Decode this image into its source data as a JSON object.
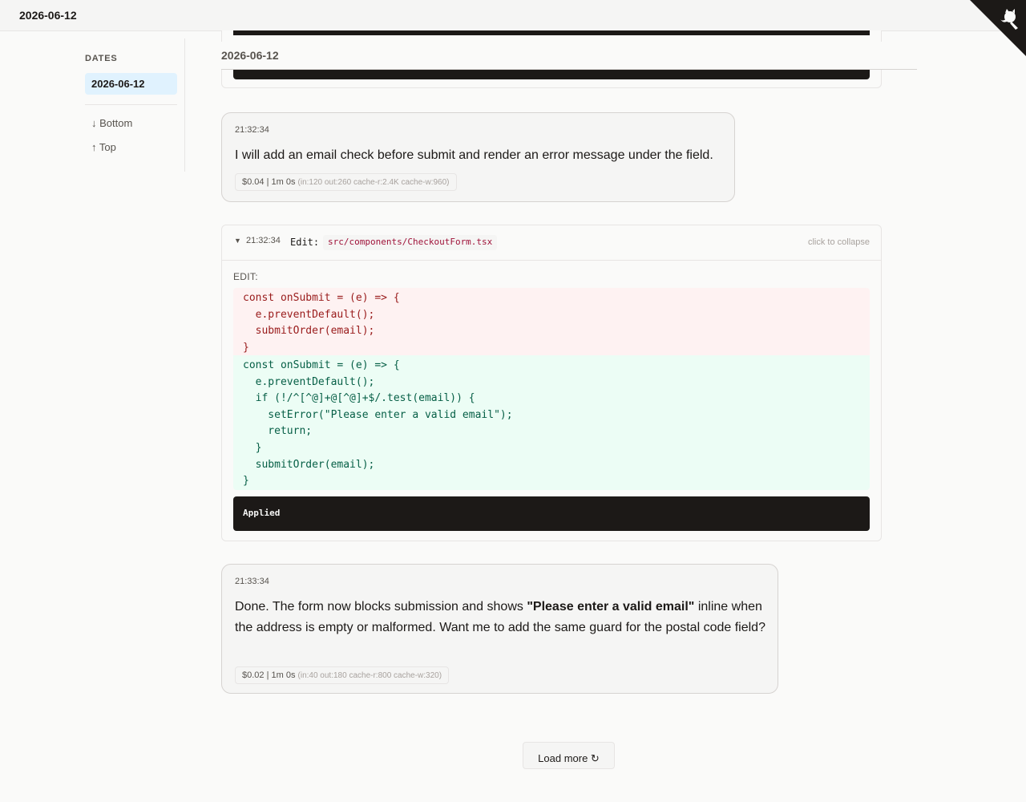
{
  "header": {
    "title": "2026-06-12"
  },
  "sidebar": {
    "heading": "DATES",
    "dates": [
      "2026-06-12"
    ],
    "bottom_link": "↓ Bottom",
    "top_link": "↑ Top"
  },
  "sticky_date": "2026-06-12",
  "messages": [
    {
      "time": "21:32:34",
      "text": "I will add an email check before submit and render an error message under the field.",
      "cost": "$0.04 | 1m 0s",
      "cost_detail": "(in:120 out:260 cache-r:2.4K cache-w:960)"
    },
    {
      "time": "21:33:34",
      "text_before": "Done. The form now blocks submission and shows ",
      "text_bold": "\"Please enter a valid email\"",
      "text_after": " inline when the address is empty or malformed. Want me to add the same guard for the postal code field?",
      "cost": "$0.02 | 1m 0s",
      "cost_detail": "(in:40 out:180 cache-r:800 cache-w:320)"
    }
  ],
  "edit": {
    "caret": "▼",
    "time": "21:32:34",
    "label": "Edit:",
    "path": "src/components/CheckoutForm.tsx",
    "collapse_hint": "click to collapse",
    "kind": "EDIT:",
    "old_lines": [
      "const onSubmit = (e) => {",
      "  e.preventDefault();",
      "  submitOrder(email);",
      "}"
    ],
    "new_lines": [
      "const onSubmit = (e) => {",
      "  e.preventDefault();",
      "  if (!/^[^@]+@[^@]+$/.test(email)) {",
      "    setError(\"Please enter a valid email\");",
      "    return;",
      "  }",
      "  submitOrder(email);",
      "}"
    ],
    "status": "Applied"
  },
  "load_more": "Load more ↻",
  "colors": {
    "accent_selected": "#e0f2fe",
    "diff_removed_bg": "#fef2f2",
    "diff_added_bg": "#ecfdf5",
    "result_bg": "#1c1917",
    "path_color": "#9f1239"
  },
  "icons": {
    "corner": "github-octocat-icon"
  }
}
